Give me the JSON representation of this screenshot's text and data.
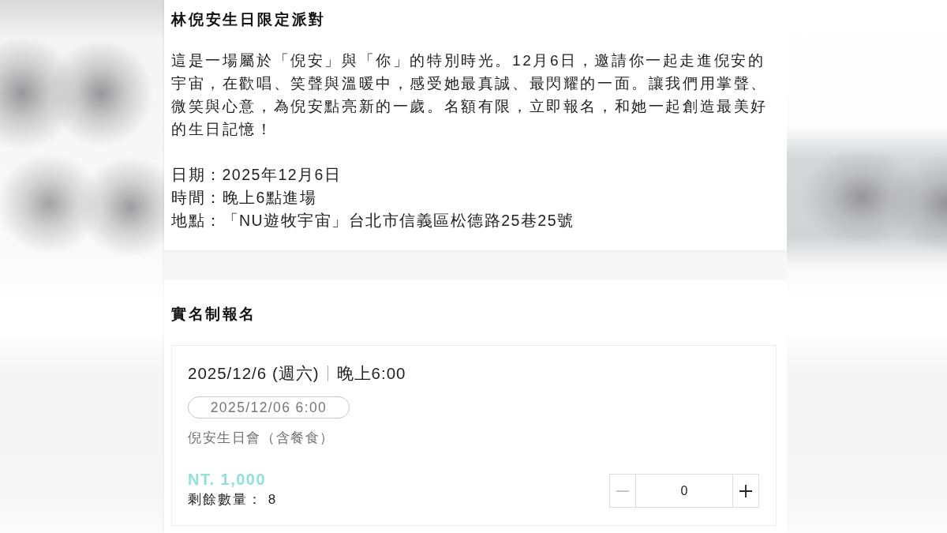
{
  "event": {
    "title": "林倪安生日限定派對",
    "description": "這是一場屬於「倪安」與「你」的特別時光。12月6日，邀請你一起走進倪安的宇宙，在歡唱、笑聲與溫暖中，感受她最真誠、最閃耀的一面。讓我們用掌聲、微笑與心意，為倪安點亮新的一歲。名額有限，立即報名，和她一起創造最美好的生日記憶！",
    "details": [
      "日期：2025年12月6日",
      "時間：晚上6點進場",
      "地點：「NU遊牧宇宙」台北市信義區松德路25巷25號"
    ]
  },
  "registration": {
    "heading": "實名制報名",
    "tickets": [
      {
        "date": "2025/12/6 (週六)",
        "time": "晚上6:00",
        "session": "2025/12/06 6:00",
        "name": "倪安生日會（含餐食）",
        "price": "NT. 1,000",
        "remaining": "剩餘數量： 8",
        "stepper": {
          "decrease": {
            "disabled": true
          },
          "value": "0",
          "increase": {
            "disabled": false
          }
        }
      }
    ]
  }
}
